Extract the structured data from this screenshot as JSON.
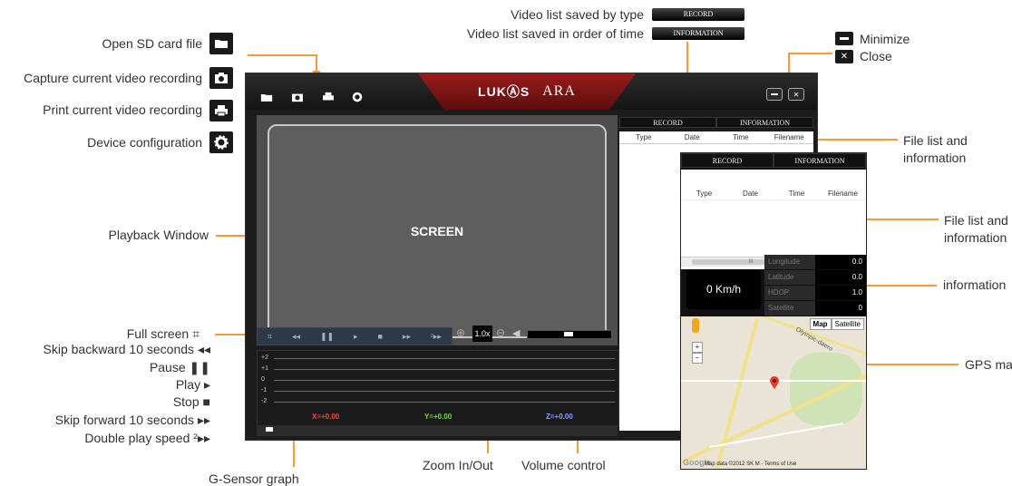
{
  "callouts": {
    "open_sd": "Open SD card file",
    "capture": "Capture current video recording",
    "print": "Print current video recording",
    "config": "Device configuration",
    "playback": "Playback Window",
    "full_screen": "Full screen",
    "skip_back": "Skip backward 10 seconds",
    "pause": "Pause",
    "play": "Play",
    "stop": "Stop",
    "skip_fwd": "Skip forward 10 seconds",
    "double_speed": "Double play speed",
    "gsensor": "G-Sensor graph",
    "zoom": "Zoom In/Out",
    "volume": "Volume control",
    "list_type": "Video list saved by type",
    "list_time": "Video list saved in order of time",
    "minimize": "Minimize",
    "close": "Close",
    "file_list_1": "File list and information",
    "file_list_2": "File list and information",
    "information": "information",
    "gps_map": "GPS map"
  },
  "list_bars": {
    "record": "RECORD",
    "information": "INFORMATION"
  },
  "app": {
    "brand": "LUKⒶS",
    "brand_suffix": "ARA",
    "screen_label": "SCREEN",
    "zoom_value": "1.0x",
    "tabs": [
      "RECORD",
      "INFORMATION"
    ],
    "file_headers": [
      "Type",
      "Date",
      "Time",
      "Filename"
    ],
    "graph": {
      "y_labels": [
        "+2",
        "+1",
        "0",
        "-1",
        "-2"
      ],
      "x_value": "X=+0.00",
      "y_value": "Y=+0.00",
      "z_value": "Z=+0.00"
    }
  },
  "panel": {
    "tabs": [
      "RECORD",
      "INFORMATION"
    ],
    "file_headers": [
      "Type",
      "Date",
      "Time",
      "Filename"
    ],
    "scroll_label": "III",
    "speed": "0 Km/h",
    "info": [
      {
        "key": "Longitude",
        "value": "0.0"
      },
      {
        "key": "Latitude",
        "value": "0.0"
      },
      {
        "key": "HDOP",
        "value": "1.0"
      },
      {
        "key": "Satellite",
        "value": "0"
      }
    ],
    "map": {
      "buttons": [
        "Map",
        "Satellite"
      ],
      "google": "Google",
      "footer": "Map data ©2012 SK M - Terms of Use",
      "street": "Olympic-daero"
    }
  },
  "colors": {
    "accent": "#f39a3c",
    "x_axis": "#ff4040",
    "y_axis": "#7cd24a",
    "z_axis": "#8aa0ff"
  }
}
